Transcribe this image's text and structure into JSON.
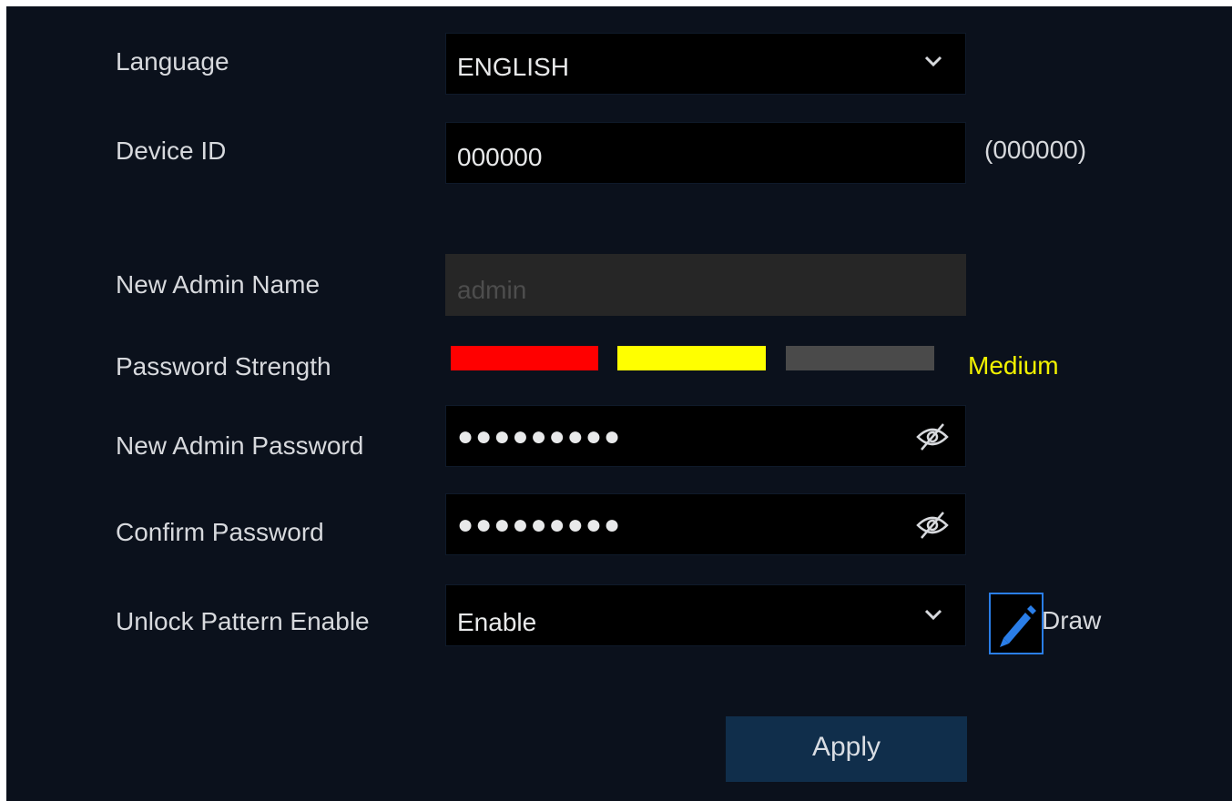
{
  "form": {
    "language": {
      "label": "Language",
      "value": "ENGLISH"
    },
    "device_id": {
      "label": "Device ID",
      "value": "000000",
      "hint": "(000000)"
    },
    "admin_name": {
      "label": "New Admin Name",
      "value": "admin"
    },
    "strength": {
      "label": "Password Strength",
      "text": "Medium",
      "level": "2 of 3",
      "colors": [
        "#ff0000",
        "#ffff00",
        "#4a4a4a"
      ],
      "text_color": "#f2f200"
    },
    "admin_password": {
      "label": "New Admin Password",
      "masked": "●●●●●●●●●"
    },
    "confirm_password": {
      "label": "Confirm Password",
      "masked": "●●●●●●●●●"
    },
    "unlock_pattern": {
      "label": "Unlock Pattern Enable",
      "value": "Enable",
      "draw_label": "Draw"
    },
    "apply_label": "Apply"
  },
  "icons": [
    "chevron-down-icon",
    "eye-hidden-icon",
    "pencil-icon"
  ],
  "colors": {
    "background": "#0b111c",
    "field": "#000000",
    "button": "#102e4b",
    "accent": "#2a7ee8"
  }
}
